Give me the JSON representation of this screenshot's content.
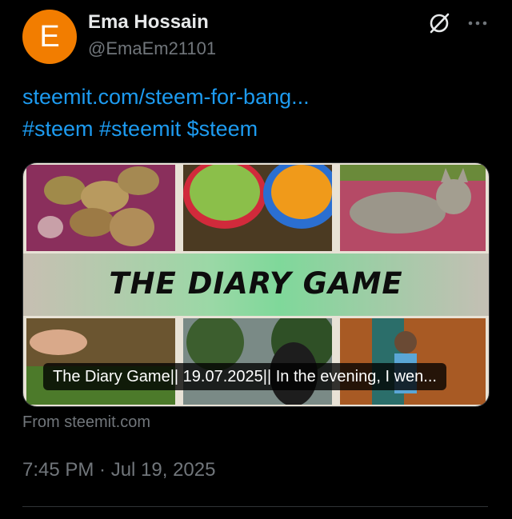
{
  "author": {
    "avatar_letter": "E",
    "avatar_color": "#f27d00",
    "name": "Ema Hossain",
    "handle": "@EmaEm21101"
  },
  "header_icons": [
    "grok-icon",
    "more-icon"
  ],
  "post": {
    "link_text": "steemit.com/steem-for-bang...",
    "hashtags": "#steem #steemit $steem",
    "link_color": "#1d9bf0"
  },
  "card": {
    "banner_title": "THE DIARY GAME",
    "caption": "The Diary Game|| 19.07.2025|| In the evening, I wen...",
    "source": "From steemit.com"
  },
  "timestamp": "7:45 PM · Jul 19, 2025"
}
